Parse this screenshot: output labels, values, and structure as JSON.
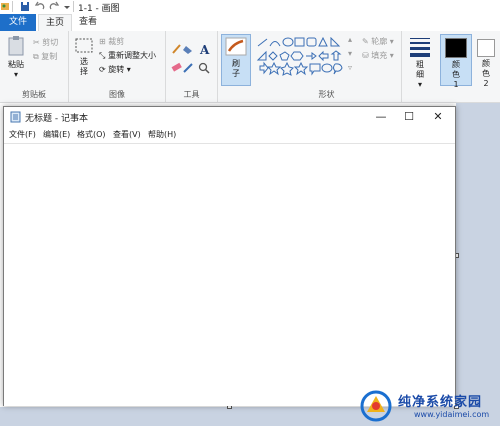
{
  "paint": {
    "title": "1-1 - 画图",
    "tabs": {
      "file": "文件",
      "home": "主页",
      "view": "查看"
    },
    "clipboard": {
      "paste": "粘贴",
      "cut": "剪切",
      "copy": "复制",
      "group": "剪贴板"
    },
    "image": {
      "select": "选择",
      "crop": "裁剪",
      "resize": "重新调整大小",
      "rotate": "旋转",
      "group": "图像"
    },
    "tools": {
      "group": "工具"
    },
    "brushes": {
      "label": "刷子"
    },
    "shapes": {
      "outline": "轮廓",
      "fill": "填充",
      "group": "形状"
    },
    "size": {
      "label": "粗细"
    },
    "colors": {
      "color1": "颜色 1",
      "color2": "颜色 2",
      "color1_value": "#000000",
      "color2_value": "#ffffff"
    }
  },
  "notepad": {
    "title": "无标题 - 记事本",
    "menus": [
      "文件(F)",
      "编辑(E)",
      "格式(O)",
      "查看(V)",
      "帮助(H)"
    ],
    "text": ""
  },
  "watermark": {
    "title": "纯净系统家园",
    "url": "www.yidaimei.com"
  }
}
